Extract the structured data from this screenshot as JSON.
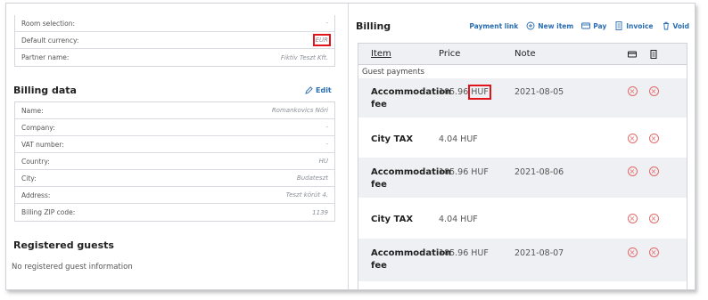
{
  "top_fields": [
    {
      "label": "Room selection:",
      "value": "-"
    },
    {
      "label": "Default currency:",
      "value": "EUR"
    },
    {
      "label": "Partner name:",
      "value": "Fiktív Teszt Kft."
    }
  ],
  "billing_data": {
    "title": "Billing data",
    "edit_label": "Edit",
    "fields": [
      {
        "label": "Name:",
        "value": "Romankovics Nóri"
      },
      {
        "label": "Company:",
        "value": "-"
      },
      {
        "label": "VAT number:",
        "value": "-"
      },
      {
        "label": "Country:",
        "value": "HU"
      },
      {
        "label": "City:",
        "value": "Budateszt"
      },
      {
        "label": "Address:",
        "value": "Teszt körút 4."
      },
      {
        "label": "Billing ZIP code:",
        "value": "1139"
      }
    ]
  },
  "registered_guests": {
    "title": "Registered guests",
    "empty_text": "No registered guest information"
  },
  "billing": {
    "title": "Billing",
    "actions": [
      {
        "label": "Payment link",
        "icon": "none"
      },
      {
        "label": "New item",
        "icon": "plus-circle-icon"
      },
      {
        "label": "Pay",
        "icon": "card-icon"
      },
      {
        "label": "Invoice",
        "icon": "invoice-icon"
      },
      {
        "label": "Void",
        "icon": "trash-icon"
      }
    ],
    "columns": {
      "item": "Item",
      "price": "Price",
      "note": "Note"
    },
    "group_label": "Guest payments",
    "rows": [
      {
        "item": "Accommodation fee",
        "price": "105.96 HUF",
        "amount": "105.96",
        "currency": "HUF",
        "note": "2021-08-05",
        "shaded": true
      },
      {
        "item": "City TAX",
        "price": "4.04 HUF",
        "note": "",
        "shaded": false
      },
      {
        "item": "Accommodation fee",
        "price": "105.96 HUF",
        "note": "2021-08-06",
        "shaded": true
      },
      {
        "item": "City TAX",
        "price": "4.04 HUF",
        "note": "",
        "shaded": false
      },
      {
        "item": "Accommodation fee",
        "price": "105.96 HUF",
        "note": "2021-08-07",
        "shaded": true
      }
    ]
  },
  "colors": {
    "link": "#2a6db0",
    "highlight": "#e1141b",
    "remove": "#e36a6a",
    "shade": "#eef0f3"
  }
}
